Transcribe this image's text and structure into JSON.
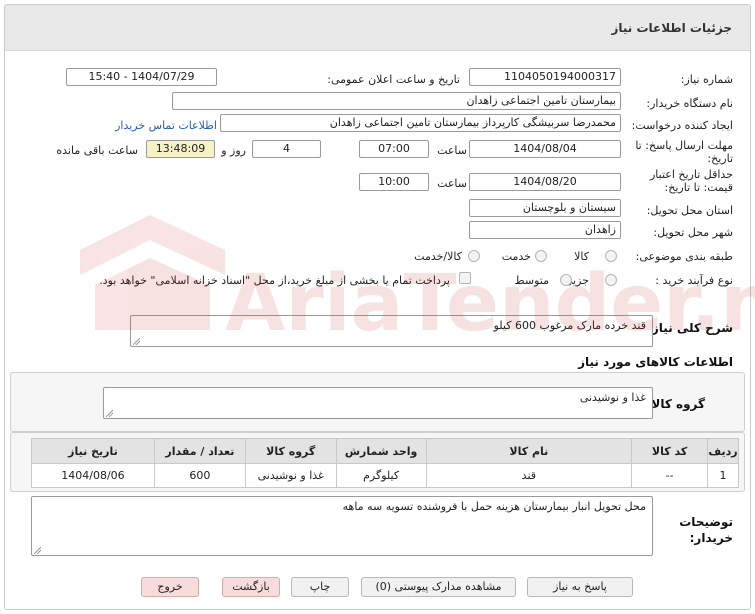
{
  "page": {
    "title": "جزئیات اطلاعات نیاز"
  },
  "need_number": {
    "label": "شماره نیاز:",
    "value": "1104050194000317"
  },
  "announce": {
    "label": "تاریخ و ساعت اعلان عمومی:",
    "value": "1404/07/29 - 15:40"
  },
  "buyer": {
    "label": "نام دستگاه خریدار:",
    "value": "بیمارستان تامین اجتماعی زاهدان"
  },
  "requester": {
    "label": "ایجاد کننده درخواست:",
    "value": "محمدرضا سربیشگی کارپرداز بیمارستان تامین اجتماعی زاهدان",
    "contact_link": "اطلاعات تماس خریدار"
  },
  "deadline": {
    "label_line1": "مهلت ارسال پاسخ: تا",
    "label_line2": "تاریخ:",
    "date": "1404/08/04",
    "time_label": "ساعت",
    "time": "07:00",
    "days": "4",
    "days_label": "روز و",
    "remaining": "13:48:09",
    "remaining_label": "ساعت باقی مانده"
  },
  "validity": {
    "label_line1": "حداقل تاریخ اعتبار",
    "label_line2": "قیمت: تا تاریخ:",
    "date": "1404/08/20",
    "time_label": "ساعت",
    "time": "10:00"
  },
  "province": {
    "label": "استان محل تحویل:",
    "value": "سیستان و بلوچستان"
  },
  "city": {
    "label": "شهر محل تحویل:",
    "value": "زاهدان"
  },
  "category": {
    "label": "طبقه بندی موضوعی:",
    "options": [
      "کالا",
      "خدمت",
      "کالا/خدمت"
    ]
  },
  "process": {
    "label": "نوع فرآیند خرید :",
    "options": [
      "جزیی",
      "متوسط"
    ],
    "payment_note": "پرداخت تمام یا بخشی از مبلغ خرید،از محل \"اسناد خزانه اسلامی\" خواهد بود."
  },
  "description": {
    "label": "شرح کلی نیاز:",
    "value": "قند خرده مارک مرغوب  600 کیلو"
  },
  "goods_info": {
    "label": "اطلاعات کالاهای مورد نیاز"
  },
  "goods_group": {
    "label": "گروه کالا:",
    "value": "غذا و نوشیدنی"
  },
  "table": {
    "headers": [
      "ردیف",
      "کد کالا",
      "نام کالا",
      "واحد شمارش",
      "گروه کالا",
      "تعداد / مقدار",
      "تاریخ نیاز"
    ],
    "rows": [
      [
        "1",
        "--",
        "قند",
        "کیلوگرم",
        "غذا و نوشیدنی",
        "600",
        "1404/08/06"
      ]
    ]
  },
  "buyer_notes": {
    "label_line1": "توضیحات",
    "label_line2": "خریدار:",
    "value": "محل تحویل انبار بیمارستان هزینه حمل با فروشنده تسویه سه ماهه"
  },
  "buttons": {
    "reply": "پاسخ به نیاز",
    "docs": "مشاهده مدارک پیوستی (0)",
    "print": "چاپ",
    "back": "بازگشت",
    "exit": "خروج"
  },
  "watermark": {
    "text": "AriaTender.neT"
  },
  "colors": {
    "header_bg": "#e9e9e9",
    "link": "#2a5db0",
    "remaining_bg": "#f7f2c6",
    "button_pink": "#f8dcdc"
  }
}
